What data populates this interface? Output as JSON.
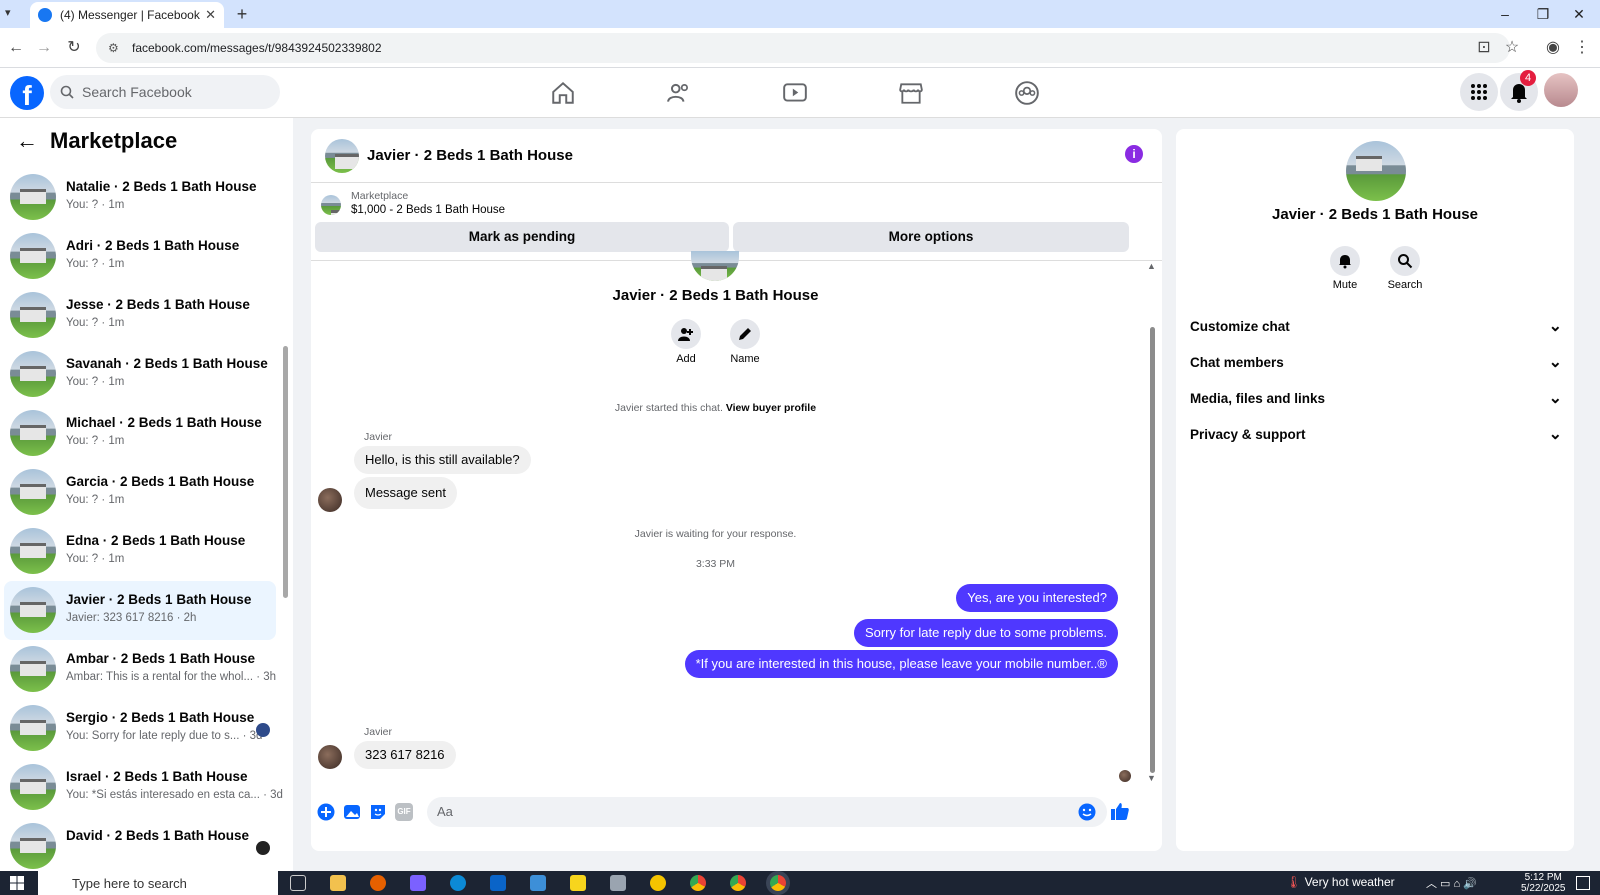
{
  "browser": {
    "tab_title": "(4) Messenger | Facebook",
    "url": "facebook.com/messages/t/9843924502339802"
  },
  "fb": {
    "search_placeholder": "Search Facebook",
    "notif_count": "4",
    "accent": "#0866ff"
  },
  "left": {
    "title": "Marketplace",
    "conversations": [
      {
        "name": "Natalie · 2 Beds 1 Bath House",
        "preview": "You: ? · 1m"
      },
      {
        "name": "Adri · 2 Beds 1 Bath House",
        "preview": "You: ? · 1m"
      },
      {
        "name": "Jesse · 2 Beds 1 Bath House",
        "preview": "You: ? · 1m"
      },
      {
        "name": "Savanah · 2 Beds 1 Bath House",
        "preview": "You: ? · 1m"
      },
      {
        "name": "Michael · 2 Beds 1 Bath House",
        "preview": "You: ? · 1m"
      },
      {
        "name": "Garcia · 2 Beds 1 Bath House",
        "preview": "You: ? · 1m"
      },
      {
        "name": "Edna · 2 Beds 1 Bath House",
        "preview": "You: ? · 1m"
      },
      {
        "name": "Javier · 2 Beds 1 Bath House",
        "preview": "Javier: 323 617 8216 · 2h",
        "selected": true
      },
      {
        "name": "Ambar · 2 Beds 1 Bath House",
        "preview": "Ambar: This is a rental for the whol... · 3h"
      },
      {
        "name": "Sergio · 2 Beds 1 Bath House",
        "preview": "You: Sorry for late reply due to s... · 3d"
      },
      {
        "name": "Israel · 2 Beds 1 Bath House",
        "preview": "You: *Si estás interesado en esta ca... · 3d"
      },
      {
        "name": "David · 2 Beds 1 Bath House",
        "preview": ""
      }
    ]
  },
  "chat": {
    "title": "Javier · 2 Beds 1 Bath House",
    "marketplace_label": "Marketplace",
    "listing": "$1,000 - 2 Beds 1 Bath House",
    "mark_pending": "Mark as pending",
    "more_options": "More options",
    "profile_name": "Javier · 2 Beds 1 Bath House",
    "add_label": "Add",
    "name_label": "Name",
    "started_text": "Javier started this chat.",
    "view_profile": "View buyer profile",
    "sender_name": "Javier",
    "msg1": "Hello, is this still available?",
    "msg2": "Message sent",
    "waiting": "Javier is waiting for your response.",
    "time": "3:33 PM",
    "out1": "Yes, are you interested?",
    "out2": "Sorry for late reply due to some problems.",
    "out3": "*If you are interested in this house, please leave your mobile number..®",
    "sender_name2": "Javier",
    "msg3": "323  617 8216",
    "composer_placeholder": "Aa",
    "bubble_color": "#4f38ff"
  },
  "right": {
    "title": "Javier · 2 Beds 1 Bath House",
    "mute": "Mute",
    "search": "Search",
    "sections": [
      "Customize chat",
      "Chat members",
      "Media, files and links",
      "Privacy & support"
    ]
  },
  "taskbar": {
    "search_placeholder": "Type here to search",
    "weather": "Very hot weather",
    "time": "5:12 PM",
    "date": "5/22/2025"
  }
}
